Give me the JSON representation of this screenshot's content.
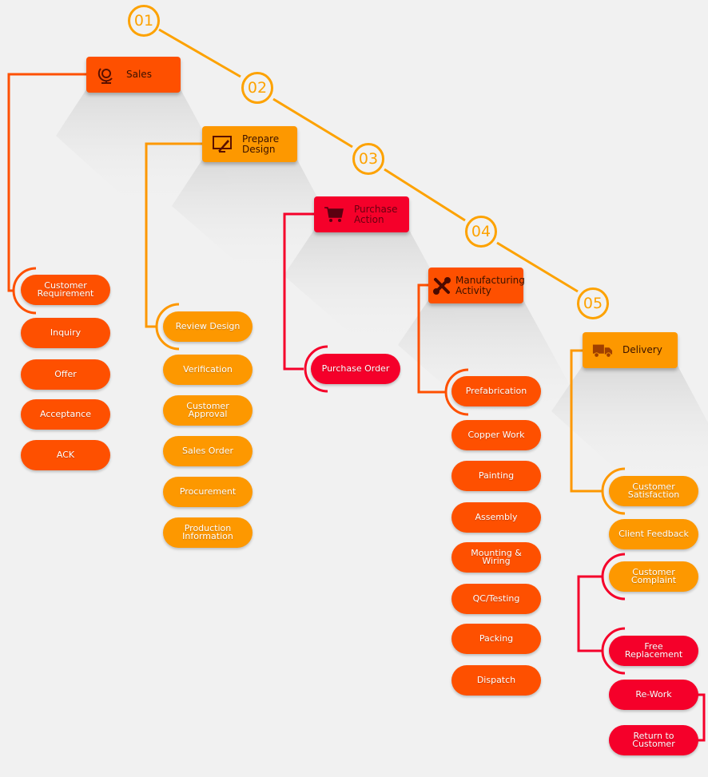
{
  "colors": {
    "background": "#f1f1f1",
    "orange_red": "#fe5000",
    "amber": "#fd9800",
    "red": "#f5002a",
    "step_line": "#fda200"
  },
  "steps": [
    {
      "number": "01",
      "title": "Sales",
      "icon": "globe-icon",
      "color": "orange_red",
      "items": [
        "Customer\nRequirement",
        "Inquiry",
        "Offer",
        "Acceptance",
        "ACK"
      ]
    },
    {
      "number": "02",
      "title": "Prepare\nDesign",
      "icon": "monitor-pen-icon",
      "color": "amber",
      "items": [
        "Review Design",
        "Verification",
        "Customer\nApproval",
        "Sales Order",
        "Procurement",
        "Production\nInformation"
      ]
    },
    {
      "number": "03",
      "title": "Purchase\nAction",
      "icon": "shopping-cart-icon",
      "color": "red",
      "items": [
        "Purchase Order"
      ]
    },
    {
      "number": "04",
      "title": "Manufacturing\nActivity",
      "icon": "tools-icon",
      "color": "orange_red",
      "items": [
        "Prefabrication",
        "Copper Work",
        "Painting",
        "Assembly",
        "Mounting &\nWiring",
        "QC/Testing",
        "Packing",
        "Dispatch"
      ]
    },
    {
      "number": "05",
      "title": "Delivery",
      "icon": "truck-icon",
      "color": "amber",
      "items": [
        "Customer\nSatisfaction",
        "Client Feedback",
        "Customer\nComplaint"
      ],
      "complaint_items": [
        "Free\nReplacement",
        "Re-Work",
        "Return to\nCustomer"
      ]
    }
  ]
}
